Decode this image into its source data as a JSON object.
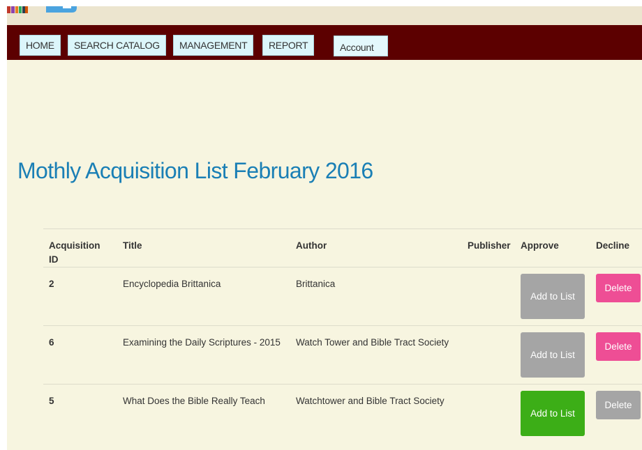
{
  "nav": {
    "items": [
      {
        "label": "HOME"
      },
      {
        "label": "SEARCH CATALOG"
      },
      {
        "label": "MANAGEMENT"
      },
      {
        "label": "REPORT"
      },
      {
        "label": "Account"
      }
    ]
  },
  "main": {
    "title": "Mothly Acquisition List February 2016",
    "table": {
      "headers": {
        "id": "Acquisition ID",
        "title": "Title",
        "author": "Author",
        "publisher": "Publisher",
        "approve": "Approve",
        "decline": "Decline"
      },
      "rows": [
        {
          "id": "2",
          "title": "Encyclopedia Brittanica",
          "author": "Brittanica",
          "publisher": "",
          "approve_label": "Add to List",
          "decline_label": "Delete",
          "approve_enabled": false,
          "decline_enabled": true
        },
        {
          "id": "6",
          "title": "Examining the Daily Scriptures - 2015",
          "author": "Watch Tower and Bible Tract Society",
          "publisher": "",
          "approve_label": "Add to List",
          "decline_label": "Delete",
          "approve_enabled": false,
          "decline_enabled": true
        },
        {
          "id": "5",
          "title": "What Does the Bible Really Teach",
          "author": "Watchtower and Bible Tract Society",
          "publisher": "",
          "approve_label": "Add to List",
          "decline_label": "Delete",
          "approve_enabled": true,
          "decline_enabled": false
        }
      ]
    }
  },
  "colors": {
    "navbar": "#5c0000",
    "page_background": "#f7f5e0",
    "title": "#1a7fb5",
    "approve_active": "#3cae17",
    "decline_active": "#ee4e95",
    "disabled": "#a5a5a5"
  }
}
